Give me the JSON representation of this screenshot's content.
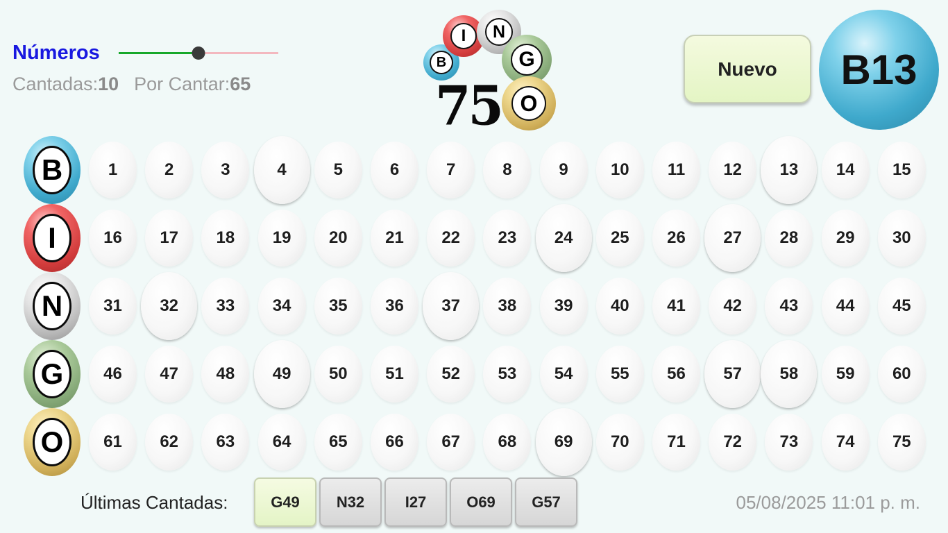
{
  "header": {
    "mode_label": "Números",
    "slider_value": 0.5,
    "cantadas_label": "Cantadas:",
    "cantadas_value": "10",
    "por_cantar_label": "Por Cantar:",
    "por_cantar_value": "65"
  },
  "logo": {
    "letters": [
      "B",
      "I",
      "N",
      "G",
      "O"
    ],
    "number": "75"
  },
  "actions": {
    "new_button_label": "Nuevo"
  },
  "current_ball": "B13",
  "board": {
    "rows": [
      {
        "letter": "B",
        "color": "blue",
        "numbers": [
          1,
          2,
          3,
          4,
          5,
          6,
          7,
          8,
          9,
          10,
          11,
          12,
          13,
          14,
          15
        ]
      },
      {
        "letter": "I",
        "color": "red",
        "numbers": [
          16,
          17,
          18,
          19,
          20,
          21,
          22,
          23,
          24,
          25,
          26,
          27,
          28,
          29,
          30
        ]
      },
      {
        "letter": "N",
        "color": "gray",
        "numbers": [
          31,
          32,
          33,
          34,
          35,
          36,
          37,
          38,
          39,
          40,
          41,
          42,
          43,
          44,
          45
        ]
      },
      {
        "letter": "G",
        "color": "green",
        "numbers": [
          46,
          47,
          48,
          49,
          50,
          51,
          52,
          53,
          54,
          55,
          56,
          57,
          58,
          59,
          60
        ]
      },
      {
        "letter": "O",
        "color": "gold",
        "numbers": [
          61,
          62,
          63,
          64,
          65,
          66,
          67,
          68,
          69,
          70,
          71,
          72,
          73,
          74,
          75
        ]
      }
    ],
    "called_numbers": [
      4,
      13,
      24,
      27,
      32,
      37,
      49,
      57,
      58,
      69
    ]
  },
  "footer": {
    "recent_label": "Últimas Cantadas:",
    "recent_calls": [
      "G49",
      "N32",
      "I27",
      "O69",
      "G57"
    ],
    "datetime": "05/08/2025 11:01 p. m."
  },
  "colors": {
    "blue": "#3fa9cc",
    "red": "#d23c3c",
    "gray": "#b6b6b6",
    "green": "#85a877",
    "gold": "#cfae58",
    "mode_label": "#1818e0",
    "slider_active": "#17a82a",
    "slider_inactive": "#f3b8bf"
  }
}
